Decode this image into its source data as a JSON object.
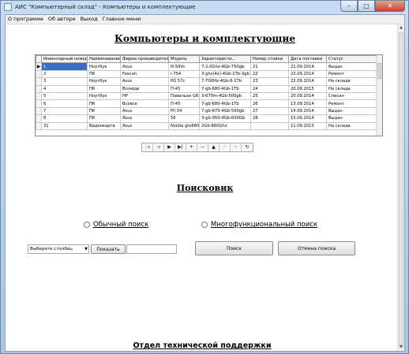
{
  "window": {
    "title": "АИС \"Компьютерный склад\" - Компьютеры и комплектующие",
    "controls": [
      "–",
      "□",
      "✕"
    ]
  },
  "menu": [
    "О программе",
    "Об авторе",
    "Выход",
    "Главное меню"
  ],
  "main_heading": "Компьютеры и комплектующие",
  "grid": {
    "columns": [
      "Инвентарный номер",
      "Наименование",
      "Фирма производитель",
      "Модель",
      "Характеристи...",
      "Номер стойки",
      "Дата поставки",
      "Статус"
    ],
    "rows": [
      [
        "1",
        "Ноутбук",
        "Asus",
        "N-50Vc",
        "7-2.0Ghz-4Gb-750gb",
        "21",
        "21.09.2014",
        "Выдан"
      ],
      [
        "2",
        "ПК",
        "Foxcon",
        "i-754",
        "3-ghz(4x)-4Gb-1Tb-3gb",
        "22",
        "22.09.2014",
        "Ремонт"
      ],
      [
        "3",
        "Ноутбук",
        "Asus",
        "PG 57c",
        "7-700Hz-4Gb-8-1Tb",
        "23",
        "22.09.2014",
        "На складе"
      ],
      [
        "4",
        "ПК",
        "Вллюди",
        "П-45",
        "7-gb-680-4Gb-1Tb",
        "24",
        "20.09.2015",
        "На складе"
      ],
      [
        "5",
        "Ноутбук",
        "HP",
        "Павильон G6",
        "3-670m-4Gb-500gb",
        "25",
        "20.09.2014",
        "Списан"
      ],
      [
        "6",
        "ПК",
        "Всевсе",
        "П-45",
        "7-gb-680-4Gb-1Tb",
        "26",
        "13.09.2014",
        "Ремонт"
      ],
      [
        "7",
        "ПК",
        "Asus",
        "Pll 34",
        "7-gb-670-4Gb-500gb",
        "27",
        "14.09.2014",
        "Выдан"
      ],
      [
        "8",
        "ПК",
        "Asus",
        "56",
        "3-gb-560-4Gb-600Gb",
        "28",
        "15.09.2014",
        "Выдан"
      ],
      [
        "31",
        "Видеокарта",
        "Asus",
        "Nvidia gtx680",
        "2Gb-860Ghz",
        "",
        "11.09.2013",
        "На складе"
      ]
    ]
  },
  "navigator": [
    "|◀",
    "◀",
    "▶",
    "▶|",
    "+",
    "−",
    "▲",
    "✓",
    "✕",
    "↻"
  ],
  "search_heading": "Поисковик",
  "search": {
    "simple_label": "Обычный поиск",
    "multi_label": "Многофункциональный поиск",
    "select_value": "Выберите столбец",
    "show_button": "Показать",
    "search_button": "Поиск",
    "cancel_button": "Отмена поиска"
  },
  "footer": "Отдел технической поддержки"
}
